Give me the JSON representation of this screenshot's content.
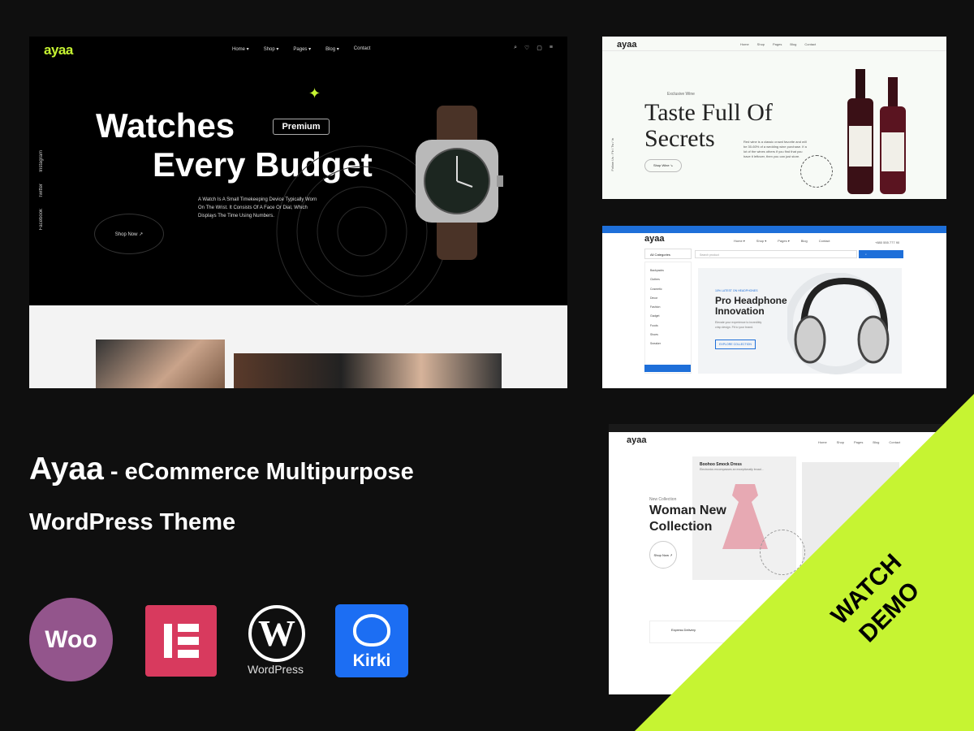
{
  "watch": {
    "logo": "ayaa",
    "nav": [
      "Home ▾",
      "Shop ▾",
      "Pages ▾",
      "Blog ▾",
      "Contact"
    ],
    "headline1": "Watches",
    "headline2": "Every Budget",
    "badge": "Premium",
    "desc": "A Watch Is A Small Timekeeping Device Typically Worn On The Wrist. It Consists Of A Face Or Dial, Which Displays The Time Using Numbers.",
    "shop": "Shop Now ↗",
    "social": [
      "Instagram",
      "Twitter",
      "Facebook"
    ]
  },
  "wine": {
    "logo": "ayaa",
    "nav": [
      "Home",
      "Shop",
      "Pages",
      "Blog",
      "Contact"
    ],
    "eyebrow": "Exclusive Wine",
    "headline": "Taste Full Of Secrets",
    "desc": "Red wine is a classic crowd favorite and will be 30-60% of a wedding wine purchase. If a lot of the wines others if you find that you have it leftover, then you can just store.",
    "button": "Shop Wine ↘",
    "side": "Follow Us : Fb / Tw / In"
  },
  "headphone": {
    "logo": "ayaa",
    "nav": [
      "Home ▾",
      "Shop ▾",
      "Pages ▾",
      "Blog",
      "Contact"
    ],
    "phone": "+880 555 777 90",
    "categories": "All Categories",
    "search_placeholder": "Search product",
    "cat_list": [
      "Backpacks",
      "Clothes",
      "Cosmetic",
      "Decor",
      "Fashion",
      "Gadget",
      "Foods",
      "Shoes",
      "Sneaker"
    ],
    "eyebrow": "10% LATEST ON HEADPHONES",
    "headline": "Pro Headphone Innovation",
    "desc": "Elevate your experience to incredibly crisp design. Fit to your brand.",
    "button": "EXPLORE COLLECTION"
  },
  "fashion": {
    "logo": "ayaa",
    "nav": [
      "Home",
      "Shop",
      "Pages",
      "Blog",
      "Contact"
    ],
    "card_title": "Boohoo Smock Dress",
    "card_desc": "Electronics encompasses an exceptionally broad...",
    "eyebrow": "New Collection",
    "headline": "Woman New Collection",
    "button": "Shop Now ↗",
    "delivery": "Express Delivery"
  },
  "title_main": "Ayaa",
  "title_sub": " - eCommerce Multipurpose",
  "title_line2": "WordPress Theme",
  "logos": {
    "woo": "Woo",
    "wordpress": "WordPress",
    "kirki": "Kirki"
  },
  "ribbon": {
    "line1": "WATCH",
    "line2": "DEMO",
    "color": "#c6f432"
  }
}
